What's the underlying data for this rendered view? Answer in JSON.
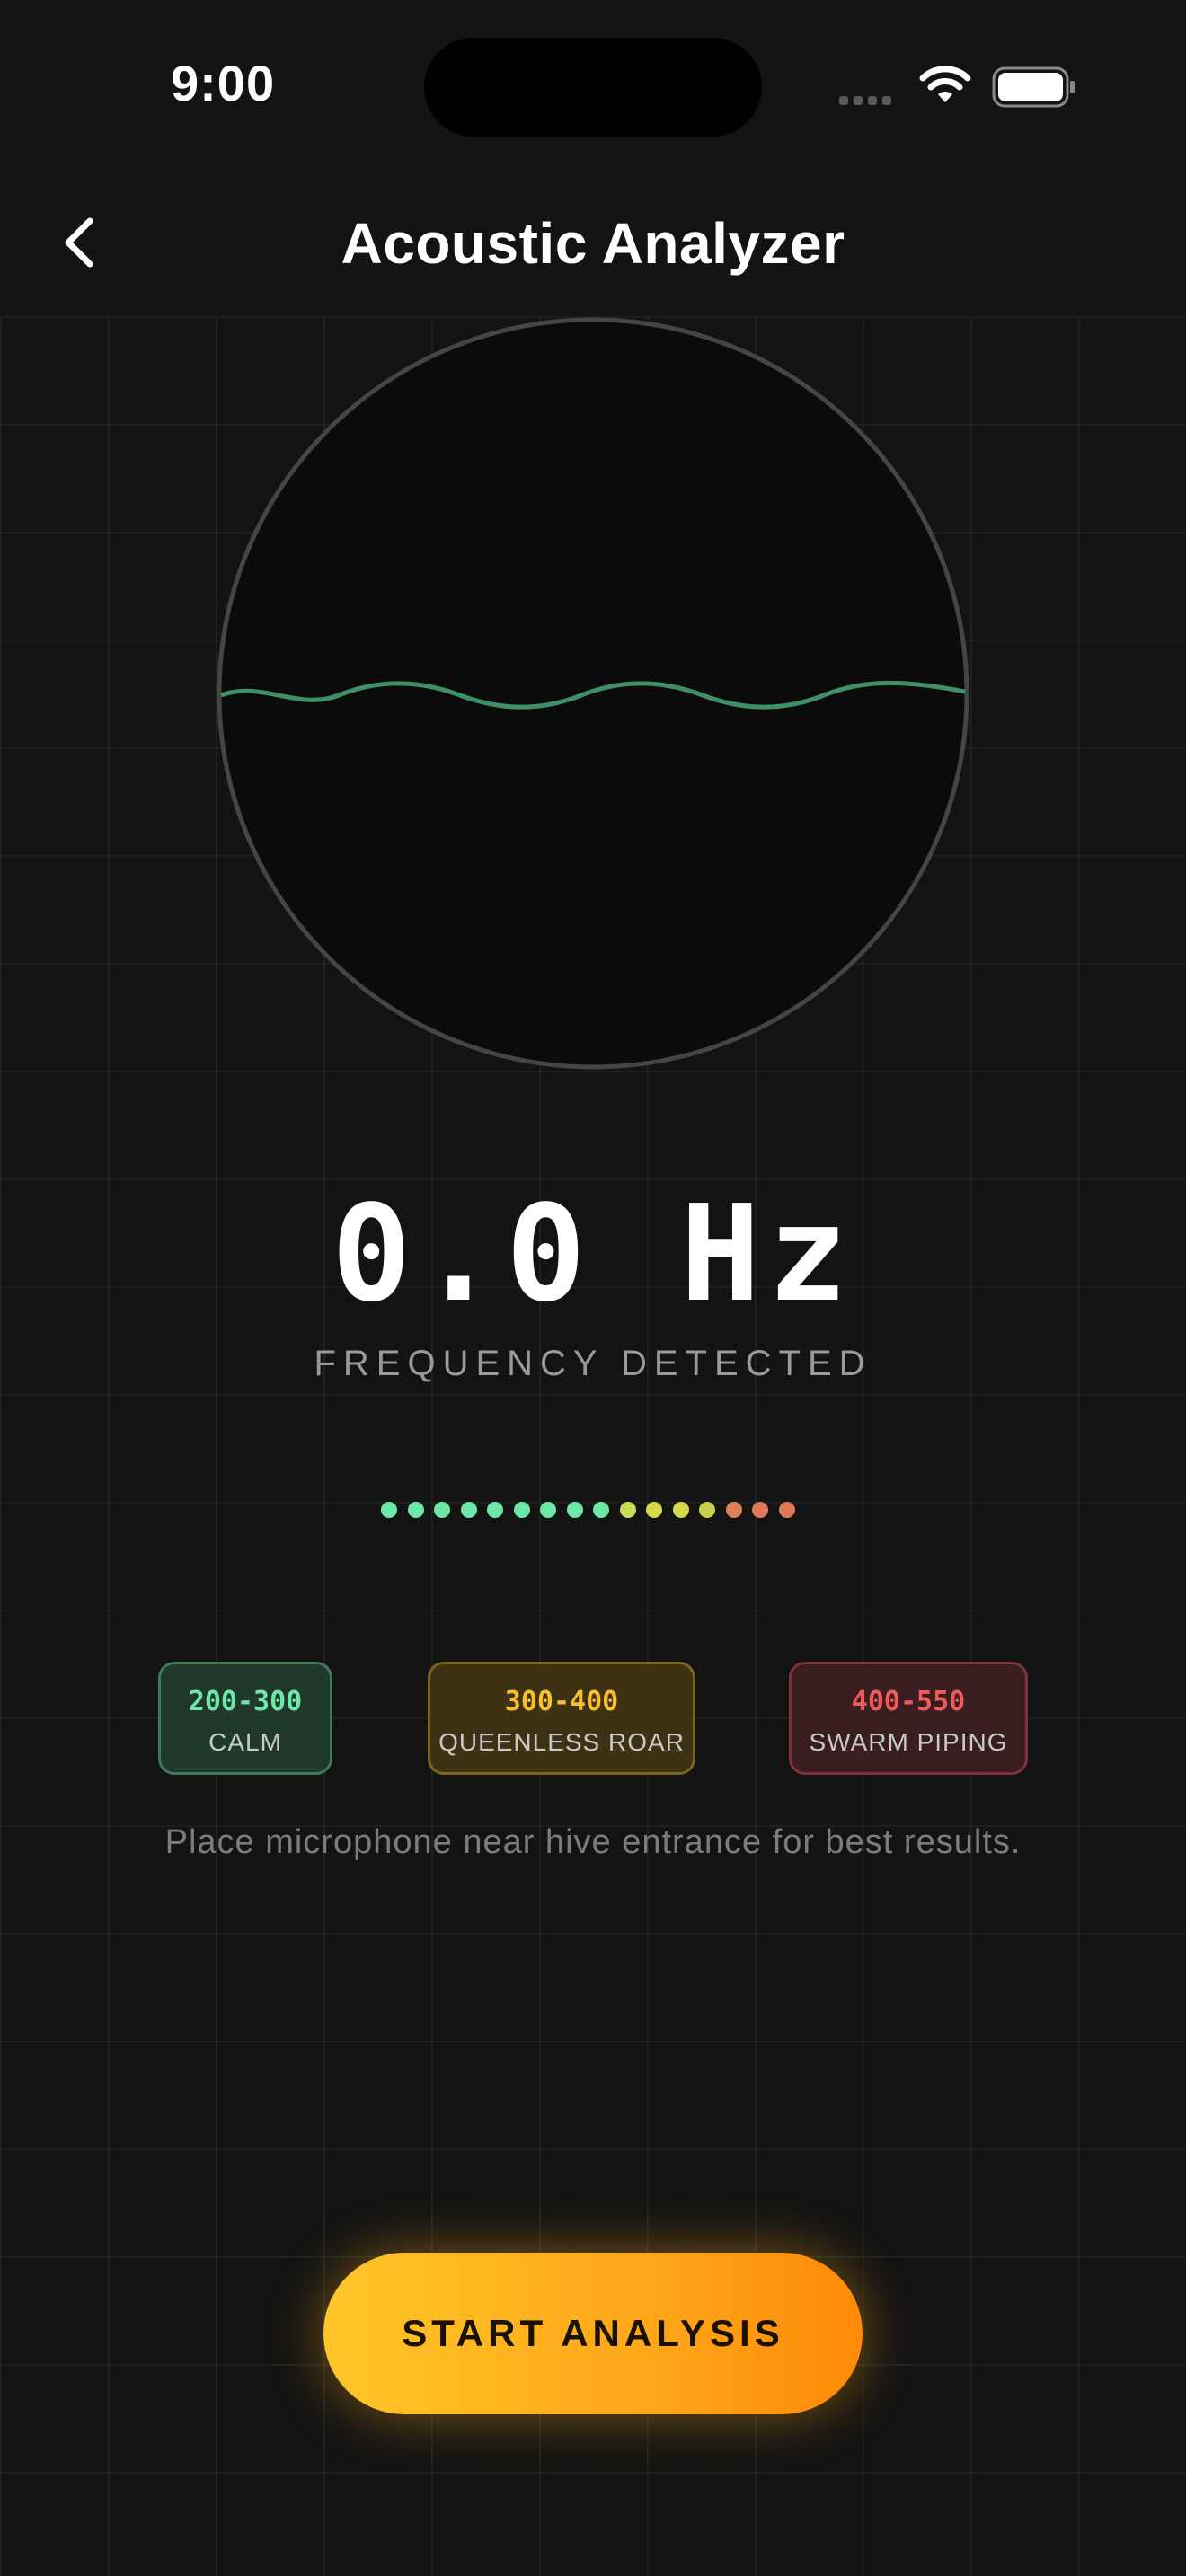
{
  "status_bar": {
    "time": "9:00"
  },
  "header": {
    "title": "Acoustic Analyzer",
    "back_icon": "chevron-left-icon"
  },
  "frequency": {
    "value": "0.0 Hz",
    "label": "FREQUENCY DETECTED"
  },
  "level_meter": {
    "colors": [
      "#6ee7a8",
      "#6ee7a8",
      "#6ee7a8",
      "#6ee7a8",
      "#6ee7a8",
      "#6ee7a8",
      "#6ee7a8",
      "#6ee7a8",
      "#6ee7a8",
      "#c9dc58",
      "#d6d84a",
      "#d6d84a",
      "#c8d04a",
      "#dc7f5a",
      "#e0795a",
      "#e0795a"
    ]
  },
  "ranges": [
    {
      "range": "200-300",
      "name": "CALM",
      "color": "#6ee7a8"
    },
    {
      "range": "300-400",
      "name": "QUEENLESS ROAR",
      "color": "#f7be2d"
    },
    {
      "range": "400-550",
      "name": "SWARM PIPING",
      "color": "#ef5b5b"
    }
  ],
  "hint": "Place microphone near hive entrance for best results.",
  "action": {
    "label": "START ANALYSIS"
  },
  "colors": {
    "accent": "#ffb01f",
    "wave": "#3f8f67",
    "background": "#131313"
  }
}
